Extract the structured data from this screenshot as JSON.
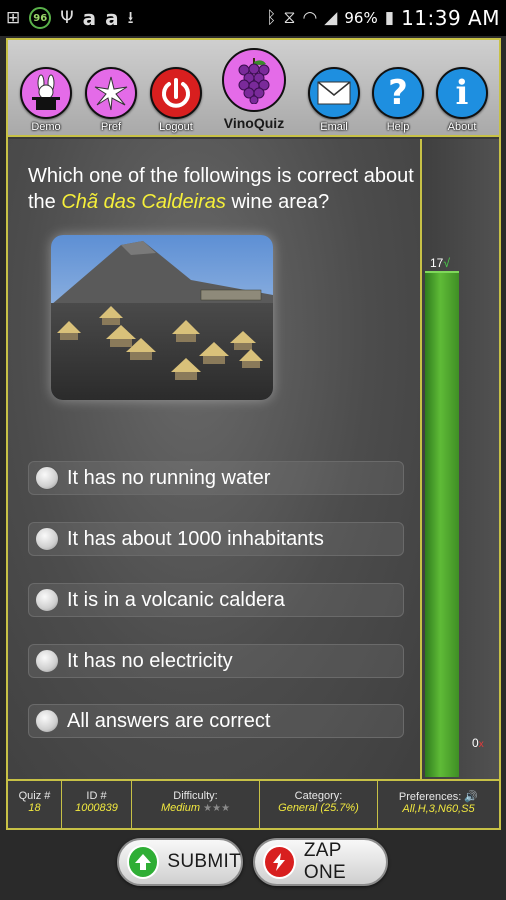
{
  "status_bar": {
    "left_icons": [
      "add-icon",
      "96-badge-icon",
      "usb-icon",
      "amazon-icon",
      "amazon-icon",
      "download-icon"
    ],
    "badge_text": "96",
    "battery": "96%",
    "time": "11:39 AM"
  },
  "toolbar": {
    "demo_label": "Demo",
    "pref_label": "Pref",
    "logout_label": "Logout",
    "app_label": "VinoQuiz",
    "email_label": "Email",
    "help_label": "Help",
    "about_label": "About"
  },
  "question": {
    "prefix": "Which one of the followings is correct about the ",
    "highlight": "Chã das Caldeiras",
    "suffix": " wine area?"
  },
  "answers": [
    "It has no running water",
    "It has about 1000 inhabitants",
    "It is in a volcanic caldera",
    "It has no electricity",
    "All answers are correct"
  ],
  "score": {
    "correct": "17",
    "correct_mark": "√",
    "wrong": "0",
    "wrong_mark": "x"
  },
  "info": {
    "quiz_label": "Quiz #",
    "quiz_value": "18",
    "id_label": "ID #",
    "id_value": "1000839",
    "difficulty_label": "Difficulty:",
    "difficulty_value": "Medium",
    "difficulty_stars": "★★★",
    "category_label": "Category:",
    "category_value": "General (25.7%)",
    "preferences_label": "Preferences:",
    "preferences_value": "All,H,3,N60,S5"
  },
  "buttons": {
    "submit_label": "SUBMIT",
    "zap_label": "ZAP ONE"
  },
  "colors": {
    "accent_border": "#c7c146",
    "highlight": "#f5ef3a",
    "bar_green": "#5fbb37"
  }
}
